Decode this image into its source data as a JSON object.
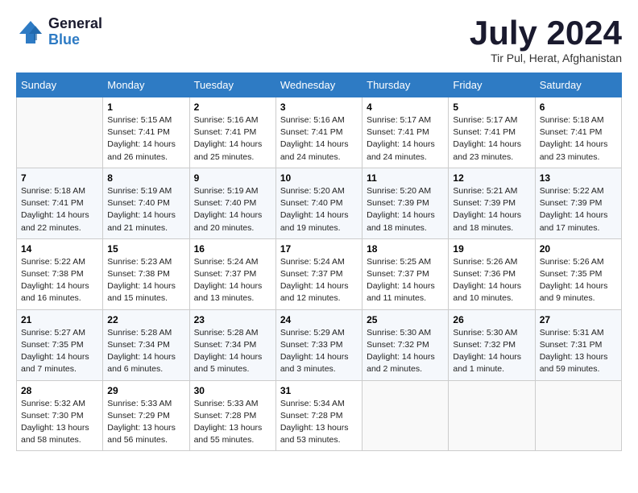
{
  "header": {
    "logo_line1": "General",
    "logo_line2": "Blue",
    "month": "July 2024",
    "location": "Tir Pul, Herat, Afghanistan"
  },
  "days_of_week": [
    "Sunday",
    "Monday",
    "Tuesday",
    "Wednesday",
    "Thursday",
    "Friday",
    "Saturday"
  ],
  "weeks": [
    [
      {
        "day": "",
        "info": ""
      },
      {
        "day": "1",
        "info": "Sunrise: 5:15 AM\nSunset: 7:41 PM\nDaylight: 14 hours\nand 26 minutes."
      },
      {
        "day": "2",
        "info": "Sunrise: 5:16 AM\nSunset: 7:41 PM\nDaylight: 14 hours\nand 25 minutes."
      },
      {
        "day": "3",
        "info": "Sunrise: 5:16 AM\nSunset: 7:41 PM\nDaylight: 14 hours\nand 24 minutes."
      },
      {
        "day": "4",
        "info": "Sunrise: 5:17 AM\nSunset: 7:41 PM\nDaylight: 14 hours\nand 24 minutes."
      },
      {
        "day": "5",
        "info": "Sunrise: 5:17 AM\nSunset: 7:41 PM\nDaylight: 14 hours\nand 23 minutes."
      },
      {
        "day": "6",
        "info": "Sunrise: 5:18 AM\nSunset: 7:41 PM\nDaylight: 14 hours\nand 23 minutes."
      }
    ],
    [
      {
        "day": "7",
        "info": "Sunrise: 5:18 AM\nSunset: 7:41 PM\nDaylight: 14 hours\nand 22 minutes."
      },
      {
        "day": "8",
        "info": "Sunrise: 5:19 AM\nSunset: 7:40 PM\nDaylight: 14 hours\nand 21 minutes."
      },
      {
        "day": "9",
        "info": "Sunrise: 5:19 AM\nSunset: 7:40 PM\nDaylight: 14 hours\nand 20 minutes."
      },
      {
        "day": "10",
        "info": "Sunrise: 5:20 AM\nSunset: 7:40 PM\nDaylight: 14 hours\nand 19 minutes."
      },
      {
        "day": "11",
        "info": "Sunrise: 5:20 AM\nSunset: 7:39 PM\nDaylight: 14 hours\nand 18 minutes."
      },
      {
        "day": "12",
        "info": "Sunrise: 5:21 AM\nSunset: 7:39 PM\nDaylight: 14 hours\nand 18 minutes."
      },
      {
        "day": "13",
        "info": "Sunrise: 5:22 AM\nSunset: 7:39 PM\nDaylight: 14 hours\nand 17 minutes."
      }
    ],
    [
      {
        "day": "14",
        "info": "Sunrise: 5:22 AM\nSunset: 7:38 PM\nDaylight: 14 hours\nand 16 minutes."
      },
      {
        "day": "15",
        "info": "Sunrise: 5:23 AM\nSunset: 7:38 PM\nDaylight: 14 hours\nand 15 minutes."
      },
      {
        "day": "16",
        "info": "Sunrise: 5:24 AM\nSunset: 7:37 PM\nDaylight: 14 hours\nand 13 minutes."
      },
      {
        "day": "17",
        "info": "Sunrise: 5:24 AM\nSunset: 7:37 PM\nDaylight: 14 hours\nand 12 minutes."
      },
      {
        "day": "18",
        "info": "Sunrise: 5:25 AM\nSunset: 7:37 PM\nDaylight: 14 hours\nand 11 minutes."
      },
      {
        "day": "19",
        "info": "Sunrise: 5:26 AM\nSunset: 7:36 PM\nDaylight: 14 hours\nand 10 minutes."
      },
      {
        "day": "20",
        "info": "Sunrise: 5:26 AM\nSunset: 7:35 PM\nDaylight: 14 hours\nand 9 minutes."
      }
    ],
    [
      {
        "day": "21",
        "info": "Sunrise: 5:27 AM\nSunset: 7:35 PM\nDaylight: 14 hours\nand 7 minutes."
      },
      {
        "day": "22",
        "info": "Sunrise: 5:28 AM\nSunset: 7:34 PM\nDaylight: 14 hours\nand 6 minutes."
      },
      {
        "day": "23",
        "info": "Sunrise: 5:28 AM\nSunset: 7:34 PM\nDaylight: 14 hours\nand 5 minutes."
      },
      {
        "day": "24",
        "info": "Sunrise: 5:29 AM\nSunset: 7:33 PM\nDaylight: 14 hours\nand 3 minutes."
      },
      {
        "day": "25",
        "info": "Sunrise: 5:30 AM\nSunset: 7:32 PM\nDaylight: 14 hours\nand 2 minutes."
      },
      {
        "day": "26",
        "info": "Sunrise: 5:30 AM\nSunset: 7:32 PM\nDaylight: 14 hours\nand 1 minute."
      },
      {
        "day": "27",
        "info": "Sunrise: 5:31 AM\nSunset: 7:31 PM\nDaylight: 13 hours\nand 59 minutes."
      }
    ],
    [
      {
        "day": "28",
        "info": "Sunrise: 5:32 AM\nSunset: 7:30 PM\nDaylight: 13 hours\nand 58 minutes."
      },
      {
        "day": "29",
        "info": "Sunrise: 5:33 AM\nSunset: 7:29 PM\nDaylight: 13 hours\nand 56 minutes."
      },
      {
        "day": "30",
        "info": "Sunrise: 5:33 AM\nSunset: 7:28 PM\nDaylight: 13 hours\nand 55 minutes."
      },
      {
        "day": "31",
        "info": "Sunrise: 5:34 AM\nSunset: 7:28 PM\nDaylight: 13 hours\nand 53 minutes."
      },
      {
        "day": "",
        "info": ""
      },
      {
        "day": "",
        "info": ""
      },
      {
        "day": "",
        "info": ""
      }
    ]
  ]
}
